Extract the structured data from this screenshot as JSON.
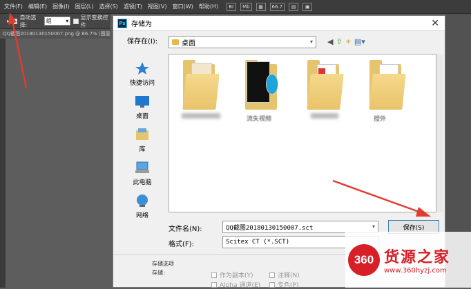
{
  "menubar": {
    "items": [
      "文件(F)",
      "编辑(E)",
      "图像(I)",
      "图层(L)",
      "选择(S)",
      "滤镜(T)",
      "视图(V)",
      "窗口(W)",
      "帮助(H)"
    ],
    "tools": [
      "Br",
      "Mb",
      "",
      "66.7",
      "",
      ""
    ]
  },
  "options": {
    "auto_select_label": "自动选择:",
    "auto_select_value": "组",
    "show_transform_label": "显示变换控件"
  },
  "document_tab": "QQ截图20180130150007.png @ 66.7% (图层",
  "dialog": {
    "title": "存储为",
    "close_glyph": "✕",
    "save_in_label": "保存在(I):",
    "save_in_value": "桌面",
    "places": [
      "快捷访问",
      "桌面",
      "库",
      "此电脑",
      "网络"
    ],
    "files": [
      {
        "name": "",
        "icon": "folder-icon"
      },
      {
        "name": "流失视频",
        "icon": "folder-icon"
      },
      {
        "name": "",
        "icon": "folder-icon"
      },
      {
        "name": "授外",
        "icon": "folder-icon"
      }
    ],
    "filename_label": "文件名(N):",
    "filename_value": "QQ截图20180130150007.sct",
    "format_label": "格式(F):",
    "format_value": "Scitex CT (*.SCT)",
    "save_button": "保存(S)",
    "options_title": "存储选项",
    "storage_label": "存储:",
    "opt_copy": "作为副本(Y)",
    "opt_notes": "注释(N)",
    "opt_alpha": "Alpha 通道(E)",
    "opt_spot": "专色(P)"
  },
  "watermark": {
    "logo_number": "360",
    "logo_text": "货源之家",
    "url": "www.360hyzj.com"
  },
  "colors": {
    "accent_red": "#d71f28",
    "arrow_red": "#e03c2f"
  }
}
